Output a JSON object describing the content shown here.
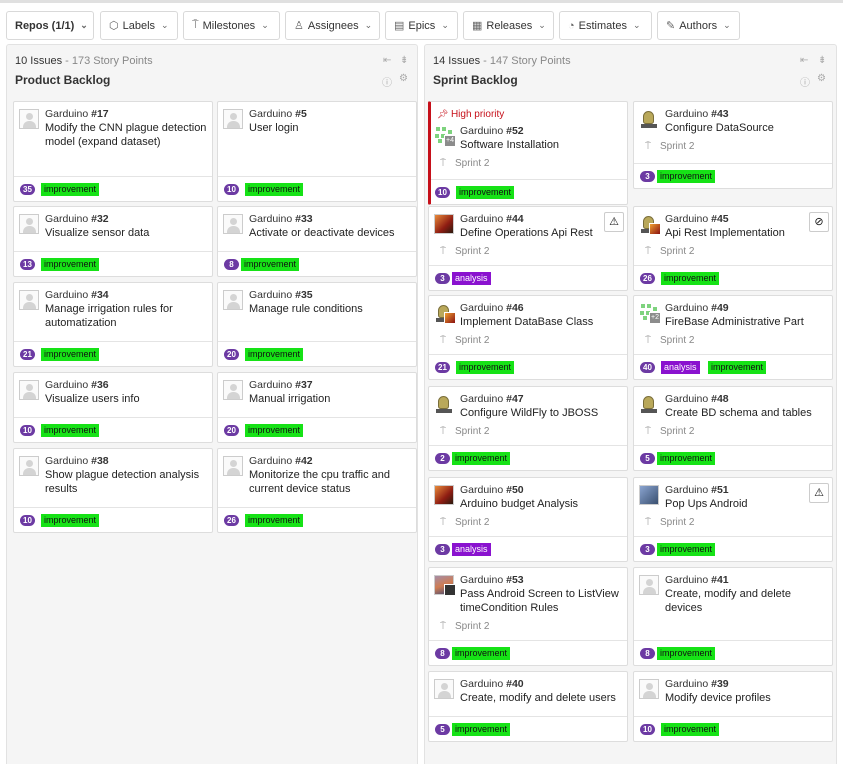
{
  "filters": [
    {
      "label": "Repos (1/1)",
      "icon": "",
      "bold": true
    },
    {
      "label": "Labels",
      "icon": "tag-icon"
    },
    {
      "label": "Milestones",
      "icon": "milestone-icon"
    },
    {
      "label": "Assignees",
      "icon": "person-icon"
    },
    {
      "label": "Epics",
      "icon": "epic-icon"
    },
    {
      "label": "Releases",
      "icon": "release-icon"
    },
    {
      "label": "Estimates",
      "icon": "estimate-icon"
    },
    {
      "label": "Authors",
      "icon": "pencil-icon"
    }
  ],
  "columns": [
    {
      "title": "Product Backlog",
      "issue_count": "10 Issues",
      "points": " - 173 Story Points",
      "cards": [
        {
          "author": "Garduino",
          "number": "#17",
          "title": "Modify the CNN plague detection model (expand dataset)",
          "points": "35",
          "labels": [
            "improvement"
          ],
          "avatar": "default"
        },
        {
          "author": "Garduino",
          "number": "#5",
          "title": "User login",
          "points": "10",
          "labels": [
            "improvement"
          ],
          "avatar": "default"
        },
        {
          "author": "Garduino",
          "number": "#32",
          "title": "Visualize sensor data",
          "points": "13",
          "labels": [
            "improvement"
          ],
          "avatar": "default"
        },
        {
          "author": "Garduino",
          "number": "#33",
          "title": "Activate or deactivate devices",
          "points": "8",
          "labels": [
            "improvement"
          ],
          "avatar": "default"
        },
        {
          "author": "Garduino",
          "number": "#34",
          "title": "Manage irrigation rules for automatization",
          "points": "21",
          "labels": [
            "improvement"
          ],
          "avatar": "default"
        },
        {
          "author": "Garduino",
          "number": "#35",
          "title": "Manage rule conditions",
          "points": "20",
          "labels": [
            "improvement"
          ],
          "avatar": "default"
        },
        {
          "author": "Garduino",
          "number": "#36",
          "title": "Visualize users info",
          "points": "10",
          "labels": [
            "improvement"
          ],
          "avatar": "default"
        },
        {
          "author": "Garduino",
          "number": "#37",
          "title": "Manual irrigation",
          "points": "20",
          "labels": [
            "improvement"
          ],
          "avatar": "default"
        },
        {
          "author": "Garduino",
          "number": "#38",
          "title": "Show plague detection analysis results",
          "points": "10",
          "labels": [
            "improvement"
          ],
          "avatar": "default"
        },
        {
          "author": "Garduino",
          "number": "#42",
          "title": "Monitorize the cpu traffic and current device status",
          "points": "26",
          "labels": [
            "improvement"
          ],
          "avatar": "default"
        }
      ]
    },
    {
      "title": "Sprint Backlog",
      "issue_count": "14 Issues",
      "points": " - 147 Story Points",
      "cards": [
        {
          "author": "Garduino",
          "number": "#52",
          "title": "Software Installation",
          "points": "10",
          "labels": [
            "improvement"
          ],
          "milestone": "Sprint 2",
          "priority": "High priority",
          "avatar": "grid",
          "sub": "+4"
        },
        {
          "author": "Garduino",
          "number": "#43",
          "title": "Configure DataSource",
          "points": "3",
          "labels": [
            "improvement"
          ],
          "milestone": "Sprint 2",
          "avatar": "bot"
        },
        {
          "author": "Garduino",
          "number": "#44",
          "title": "Define Operations Api Rest",
          "points": "3",
          "labels": [
            "analysis"
          ],
          "milestone": "Sprint 2",
          "avatar": "img1",
          "warning": "⚠"
        },
        {
          "author": "Garduino",
          "number": "#45",
          "title": "Api Rest Implementation",
          "points": "26",
          "labels": [
            "improvement"
          ],
          "milestone": "Sprint 2",
          "avatar": "bot",
          "sub": "fire",
          "warning": "⊘"
        },
        {
          "author": "Garduino",
          "number": "#46",
          "title": "Implement DataBase Class",
          "points": "21",
          "labels": [
            "improvement"
          ],
          "milestone": "Sprint 2",
          "avatar": "bot",
          "sub": "fire"
        },
        {
          "author": "Garduino",
          "number": "#49",
          "title": "FireBase Administrative Part",
          "points": "40",
          "labels": [
            "analysis",
            "improvement"
          ],
          "milestone": "Sprint 2",
          "avatar": "grid",
          "sub": "+2"
        },
        {
          "author": "Garduino",
          "number": "#47",
          "title": "Configure WildFly to JBOSS",
          "points": "2",
          "labels": [
            "improvement"
          ],
          "milestone": "Sprint 2",
          "avatar": "bot"
        },
        {
          "author": "Garduino",
          "number": "#48",
          "title": "Create BD schema and tables",
          "points": "5",
          "labels": [
            "improvement"
          ],
          "milestone": "Sprint 2",
          "avatar": "bot"
        },
        {
          "author": "Garduino",
          "number": "#50",
          "title": "Arduino budget Analysis",
          "points": "3",
          "labels": [
            "analysis"
          ],
          "milestone": "Sprint 2",
          "avatar": "img1"
        },
        {
          "author": "Garduino",
          "number": "#51",
          "title": "Pop Ups Android",
          "points": "3",
          "labels": [
            "improvement"
          ],
          "milestone": "Sprint 2",
          "avatar": "img3",
          "warning": "⚠"
        },
        {
          "author": "Garduino",
          "number": "#53",
          "title": "Pass Android Screen to ListView timeCondition Rules",
          "points": "8",
          "labels": [
            "improvement"
          ],
          "milestone": "Sprint 2",
          "avatar": "img2",
          "sub": "dark"
        },
        {
          "author": "Garduino",
          "number": "#41",
          "title": "Create, modify and delete devices",
          "points": "8",
          "labels": [
            "improvement"
          ],
          "avatar": "default"
        },
        {
          "author": "Garduino",
          "number": "#40",
          "title": "Create, modify and delete users",
          "points": "5",
          "labels": [
            "improvement"
          ],
          "avatar": "default"
        },
        {
          "author": "Garduino",
          "number": "#39",
          "title": "Modify device profiles",
          "points": "10",
          "labels": [
            "improvement"
          ],
          "avatar": "default"
        }
      ]
    }
  ],
  "colors": {
    "improvement": "#16e216",
    "analysis": "#8a12cf",
    "points_badge": "#6c3aa3",
    "priority": "#c6101a"
  }
}
